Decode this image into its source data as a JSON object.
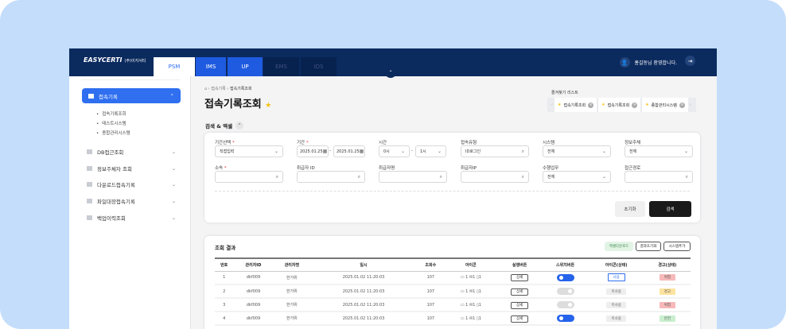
{
  "header": {
    "logo": "EASYCERTI",
    "logo_sub": "(주)이지서티",
    "tabs": [
      "PSM",
      "IMS",
      "UP",
      "EMS",
      "IDS"
    ],
    "active_tab": "PSM",
    "welcome": "홍길동님 환영합니다."
  },
  "sidebar": {
    "active": {
      "label": "접속기록",
      "subs": [
        "접속기록조회",
        "테스트시스템",
        "종합관리시스템"
      ]
    },
    "items": [
      {
        "label": "DB접근조회"
      },
      {
        "label": "정보주체자 조회"
      },
      {
        "label": "다운로드접속기록"
      },
      {
        "label": "파일대장접속기록"
      },
      {
        "label": "백업이력조회"
      }
    ]
  },
  "breadcrumb": [
    "접속기록",
    "접속기록조회"
  ],
  "page_title": "접속기록조회",
  "favorites": {
    "title": "즐겨찾기 리스트",
    "items": [
      "접속기록조회",
      "접속기록조회",
      "종합관리시스템"
    ]
  },
  "search": {
    "title": "검색 & 엑셀",
    "fields": [
      {
        "label": "기간선택",
        "required": "*",
        "value": "직접입력",
        "kind": "select"
      },
      {
        "label": "기간",
        "required": "*",
        "from": "2025.01.25",
        "to": "2025.01.25",
        "kind": "date"
      },
      {
        "label": "시간",
        "from": "0시",
        "to": "1시",
        "kind": "time"
      },
      {
        "label": "접속유형",
        "value": "ID로그인",
        "kind": "search"
      },
      {
        "label": "시스템",
        "value": "전체",
        "kind": "select"
      },
      {
        "label": "정보주체",
        "value": "전체",
        "kind": "select"
      },
      {
        "label": "소속",
        "required": "*",
        "value": "",
        "kind": "search"
      },
      {
        "label": "취급자 ID",
        "value": "",
        "kind": "search"
      },
      {
        "label": "취급자명",
        "value": "",
        "kind": "search"
      },
      {
        "label": "취급자IP",
        "value": "",
        "kind": "search"
      },
      {
        "label": "수행업무",
        "value": "전체",
        "kind": "select"
      },
      {
        "label": "접근경로",
        "value": "",
        "kind": "search"
      }
    ],
    "reset": "초기화",
    "submit": "검색"
  },
  "results": {
    "title": "조회 결과",
    "buttons": [
      "엑셀다운로드",
      "결과초기화",
      "시스템추가"
    ],
    "columns": [
      "번호",
      "관리자ID",
      "관리자명",
      "일시",
      "조회수",
      "아이콘",
      "실행버튼",
      "스위치버튼",
      "아이콘(상태)",
      "경고(상태)"
    ],
    "rows": [
      {
        "no": "1",
        "id": "dkf009",
        "name": "한가위",
        "date": "2025.01.02 11:20:03",
        "views": "107",
        "icons": [
          "1",
          "1",
          "1"
        ],
        "action": "상세",
        "switch": true,
        "icon_status": "사용",
        "warn": "위험",
        "warn_color": "#f7b9b9"
      },
      {
        "no": "2",
        "id": "dkf009",
        "name": "한가위",
        "date": "2025.01.02 11:20:03",
        "views": "107",
        "icons": [
          "1",
          "1",
          "1"
        ],
        "action": "상세",
        "switch": false,
        "icon_status": "미사용",
        "warn": "경고",
        "warn_color": "#fde3a0"
      },
      {
        "no": "3",
        "id": "dkf009",
        "name": "한가위",
        "date": "2025.01.02 11:20:03",
        "views": "107",
        "icons": [
          "1",
          "1",
          "1"
        ],
        "action": "상세",
        "switch": false,
        "icon_status": "미사용",
        "warn": "위험",
        "warn_color": "#f7b9b9"
      },
      {
        "no": "4",
        "id": "dkf009",
        "name": "한가위",
        "date": "2025.01.02 11:20:03",
        "views": "107",
        "icons": [
          "1",
          "1",
          "1"
        ],
        "action": "상세",
        "switch": true,
        "icon_status": "미사용",
        "warn": "안전",
        "warn_color": "#c9efcf"
      }
    ]
  }
}
